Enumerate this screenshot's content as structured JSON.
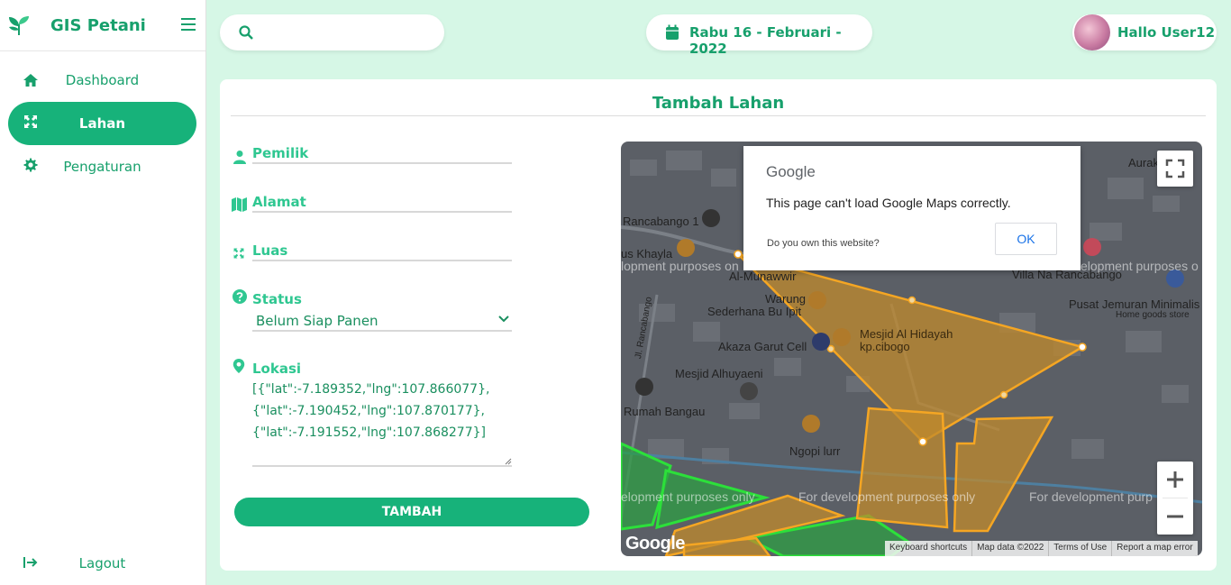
{
  "app": {
    "title": "GIS Petani"
  },
  "sidebar": {
    "items": [
      {
        "label": "Dashboard",
        "icon": "home-icon"
      },
      {
        "label": "Lahan",
        "icon": "expand-icon",
        "active": true
      },
      {
        "label": "Pengaturan",
        "icon": "gear-icon"
      }
    ],
    "logout_label": "Lagout"
  },
  "header": {
    "search": {
      "placeholder": "",
      "icon": "search-icon"
    },
    "date": "Rabu 16 - Februari - 2022",
    "user_greeting": "Hallo User12"
  },
  "form": {
    "title": "Tambah Lahan",
    "pemilik_label": "Pemilik",
    "alamat_label": "Alamat",
    "luas_label": "Luas",
    "status_label": "Status",
    "status_value": "Belum Siap Panen",
    "lokasi_label": "Lokasi",
    "lokasi_value": "[{\"lat\":-7.189352,\"lng\":107.866077},\n{\"lat\":-7.190452,\"lng\":107.870177},\n{\"lat\":-7.191552,\"lng\":107.868277}]",
    "submit_label": "TAMBAH"
  },
  "map": {
    "dialog": {
      "brand": "Google",
      "message": "This page can't load Google Maps correctly.",
      "own_website": "Do you own this website?",
      "ok_label": "OK"
    },
    "labels": {
      "rancabango1": "Rancabango 1",
      "khayla": "us Khayla",
      "almunawwir": "Al-Munawwir",
      "warung": "Warung",
      "sederhana": "Sederhana Bu Ipit",
      "mesjid_hidayah": "Mesjid Al Hidayah\nkp.cibogo",
      "akaza": "Akaza Garut Cell",
      "alhuyaeni": "Mesjid Alhuyaeni",
      "rumah_bangau": "Rumah Bangau",
      "ngopi": "Ngopi lurr",
      "villa": "Villa Na Rancabango",
      "jemuran": "Pusat Jemuran Minimalis",
      "home_goods": "Home goods store",
      "aurak": "Aurak",
      "jl_rancabango": "Jl. Rancabango",
      "dev_purposes": "For development purposes only",
      "dev_purposes_left": "elopment purposes only",
      "dev_purposes_mid": "For development purposes only",
      "dev_purposes_right_top": "elopment purposes o",
      "dev_purposes_left_top": "lopment purposes on",
      "dev_purposes_right": "For development purp"
    },
    "footer": [
      "Keyboard shortcuts",
      "Map data ©2022",
      "Terms of Use",
      "Report a map error"
    ],
    "logo_text": "Google",
    "colors": {
      "polygon_orange": "#f5a623",
      "polygon_green": "#2fbf3f",
      "map_bg": "#5b5f66"
    }
  }
}
